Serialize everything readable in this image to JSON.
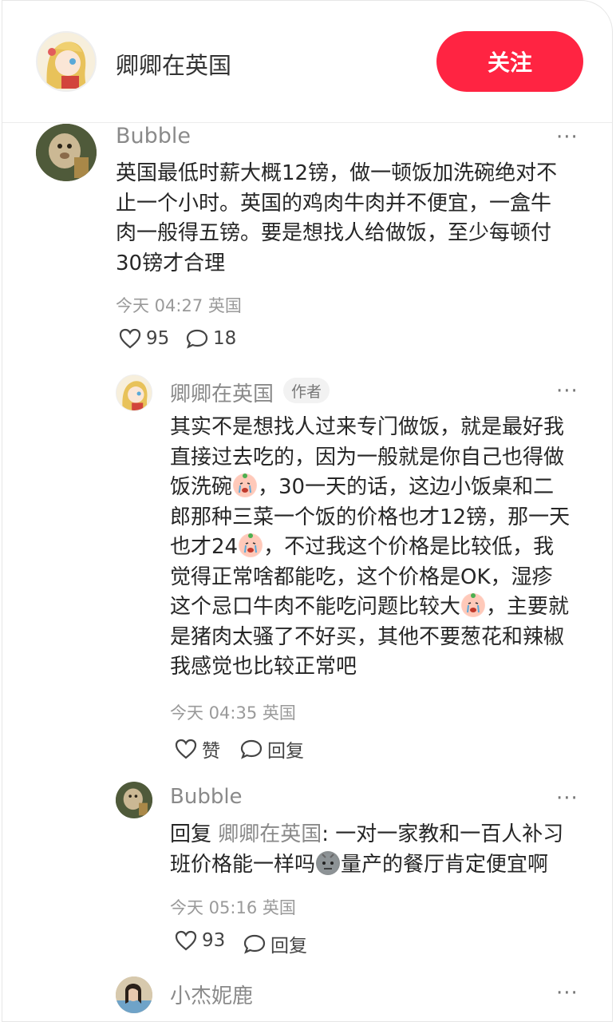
{
  "header": {
    "user_name": "卿卿在英国",
    "follow_label": "关注"
  },
  "comments": {
    "c1": {
      "author": "Bubble",
      "lines": [
        "英国最低时薪大概12镑，做一顿饭加洗碗绝对不",
        "止一个小时。英国的鸡肉牛肉并不便宜，一盒牛",
        "肉一般得五镑。要是想找人给做饭，至少每顿付",
        "30镑才合理"
      ],
      "time_location": "今天 04:27 英国",
      "likes": "95",
      "replies": "18"
    },
    "r1": {
      "author": "卿卿在英国",
      "badge": "作者",
      "l1": "其实不是想找人过来专门做饭，就是最好我",
      "l2": "直接过去吃的，因为一般就是你自己也得做",
      "l3a": "饭洗碗",
      "l3b": "，30一天的话，这边小饭桌和二",
      "l4": "郎那种三菜一个饭的价格也才12镑，那一天",
      "l5a": "也才24",
      "l5b": "，不过我这个价格是比较低，我",
      "l6": "觉得正常啥都能吃，这个价格是OK，湿疹",
      "l7a": "这个忌口牛肉不能吃问题比较大",
      "l7b": "，主要就",
      "l8": "是猪肉太骚了不好买，其他不要葱花和辣椒",
      "l9": "我感觉也比较正常吧",
      "time_location": "今天 04:35 英国",
      "like_label": "赞",
      "reply_label": "回复"
    },
    "r2": {
      "author": "Bubble",
      "reply_prefix": "回复 ",
      "mention": "卿卿在英国",
      "l1": ": 一对一家教和一百人补习",
      "l2a": "班价格能一样吗",
      "l2b": "量产的餐厅肯定便宜啊",
      "time_location": "今天 05:16 英国",
      "likes": "93",
      "reply_label": "回复"
    },
    "r3": {
      "author": "小杰妮鹿"
    }
  },
  "more_label": "···",
  "icons": {
    "heart": "heart-icon",
    "comment": "comment-bubble-icon",
    "emoji_cry": "crying-face-emoji",
    "emoji_grim": "grim-face-emoji"
  },
  "colors": {
    "accent": "#ff2442"
  }
}
